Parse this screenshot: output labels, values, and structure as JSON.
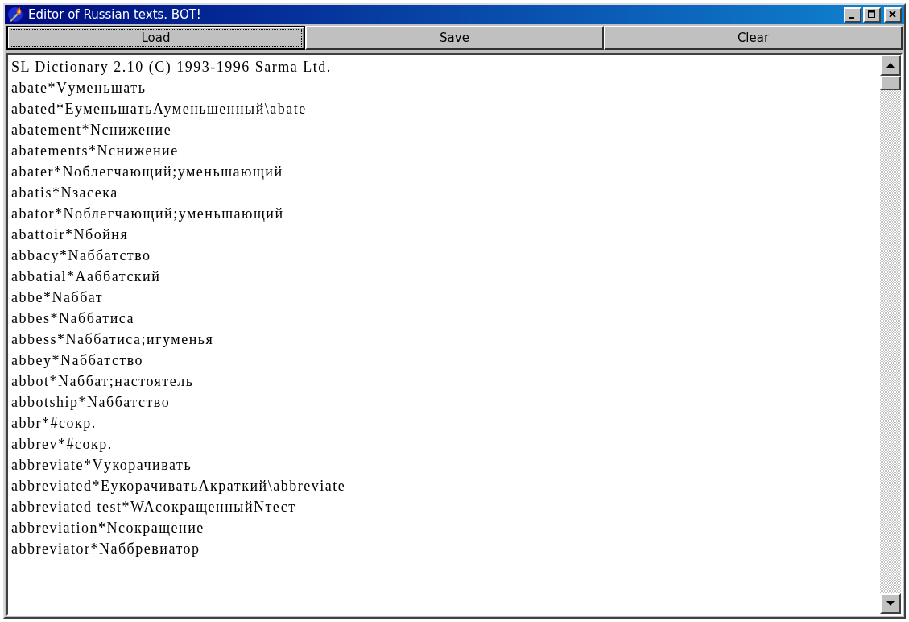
{
  "window": {
    "title": "Editor of Russian texts. BOT!"
  },
  "buttons": [
    {
      "label": "Load",
      "focused": true
    },
    {
      "label": "Save",
      "focused": false
    },
    {
      "label": "Clear",
      "focused": false
    }
  ],
  "editor": {
    "lines": [
      "SL Dictionary 2.10 (C) 1993-1996 Sarma Ltd.",
      "abate*Vуменьшать",
      "abated*ЕуменьшатьАуменьшенный\\abate",
      "abatement*Nснижение",
      "abatements*Nснижение",
      "abater*Nоблегчающий;уменьшающий",
      "abatis*Nзасека",
      "abator*Nоблегчающий;уменьшающий",
      "abattoir*Nбойня",
      "abbacy*Nаббатство",
      "abbatial*Aаббатский",
      "abbe*Nаббат",
      "abbes*Nаббатиса",
      "abbess*Nаббатиса;игуменья",
      "abbey*Nаббатство",
      "abbot*Nаббат;настоятель",
      "abbotship*Nаббатство",
      "abbr*#сокр.",
      "abbrev*#сокр.",
      "abbreviate*Vукорачивать",
      "abbreviated*ЕукорачиватьАкраткий\\abbreviate",
      "abbreviated test*WAсокращенныйNтест",
      "abbreviation*Nсокращение",
      "abbreviator*Nаббревиатор"
    ]
  }
}
